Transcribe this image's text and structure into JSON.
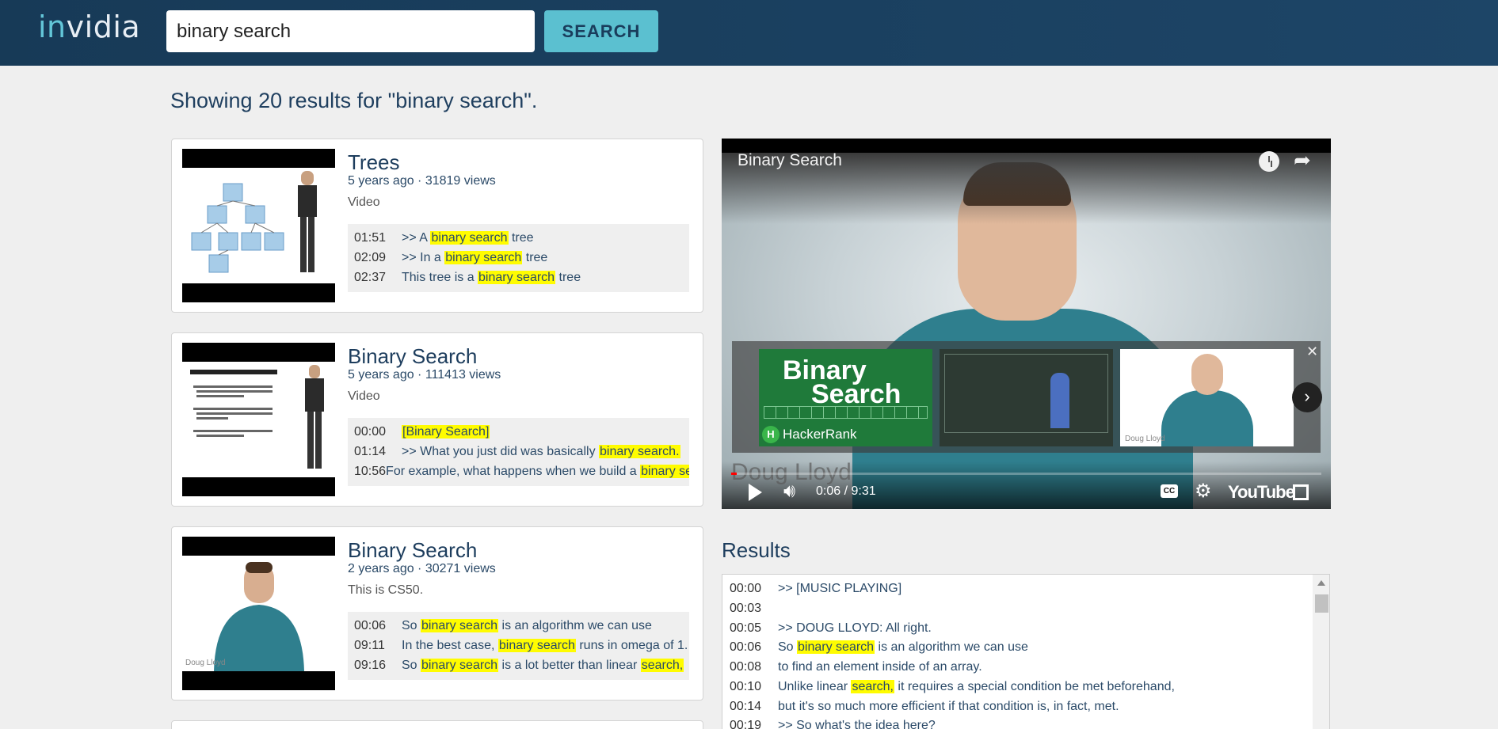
{
  "header": {
    "logo_prefix": "in",
    "logo_suffix": "vidia",
    "search_value": "binary search",
    "search_button": "SEARCH"
  },
  "summary": "Showing 20 results for \"binary search\".",
  "results": [
    {
      "title": "Trees",
      "meta": "5 years ago · 31819 views",
      "type": "Video",
      "snippets": [
        {
          "time": "01:51",
          "pre": ">> A ",
          "hit": "binary search",
          "post": " tree"
        },
        {
          "time": "02:09",
          "pre": ">> In a ",
          "hit": "binary search",
          "post": " tree"
        },
        {
          "time": "02:37",
          "pre": "This tree is a ",
          "hit": "binary search",
          "post": " tree"
        }
      ]
    },
    {
      "title": "Binary Search",
      "meta": "5 years ago · 111413 views",
      "type": "Video",
      "snippets": [
        {
          "time": "00:00",
          "pre": "",
          "hit": "[Binary Search]",
          "post": ""
        },
        {
          "time": "01:14",
          "pre": ">> What you just did was basically ",
          "hit": "binary search.",
          "post": ""
        },
        {
          "time": "10:56",
          "pre": "For example, what happens when we build a ",
          "hit": "binary sear",
          "post": ""
        }
      ]
    },
    {
      "title": "Binary Search",
      "meta": "2 years ago · 30271 views",
      "type": "This is CS50.",
      "thumb_watermark": "Doug Lloyd",
      "snippets": [
        {
          "time": "00:06",
          "pre": "So ",
          "hit": "binary search",
          "post": " is an algorithm we can use"
        },
        {
          "time": "09:11",
          "pre": "In the best case, ",
          "hit": "binary search",
          "post": " runs in omega of 1."
        },
        {
          "time": "09:16",
          "pre": "So ",
          "hit": "binary search",
          "post": " is a lot better than linear ",
          "hit2": "search,"
        }
      ]
    }
  ],
  "player": {
    "title": "Binary Search",
    "time": "0:06 / 9:31",
    "progress": 0.01,
    "watermark": "Doug Lloyd",
    "youtube": "YouTube",
    "endscreen": {
      "hr_line1": "Binary",
      "hr_line2": "Search",
      "hr_brand": "HackerRank",
      "hr_badge": "H",
      "cs50_watermark": "Doug Lloyd"
    }
  },
  "transcript": {
    "heading": "Results",
    "lines": [
      {
        "time": "00:00",
        "pre": ">> [MUSIC PLAYING]",
        "hit": "",
        "post": ""
      },
      {
        "time": "00:03",
        "pre": "",
        "hit": "",
        "post": ""
      },
      {
        "time": "00:05",
        "pre": ">> DOUG LLOYD: All right.",
        "hit": "",
        "post": ""
      },
      {
        "time": "00:06",
        "pre": "So ",
        "hit": "binary search",
        "post": " is an algorithm we can use"
      },
      {
        "time": "00:08",
        "pre": "to find an element inside of an array.",
        "hit": "",
        "post": ""
      },
      {
        "time": "00:10",
        "pre": "Unlike linear ",
        "hit": "search,",
        "post": " it requires a special condition be met beforehand,"
      },
      {
        "time": "00:14",
        "pre": "but it's so much more efficient if that condition is, in fact, met.",
        "hit": "",
        "post": ""
      },
      {
        "time": "00:19",
        "pre": ">> So what's the idea here?",
        "hit": "",
        "post": ""
      }
    ]
  },
  "colors": {
    "header": "#1a4060",
    "accent": "#5bc0d0",
    "highlight": "#fffc00"
  }
}
